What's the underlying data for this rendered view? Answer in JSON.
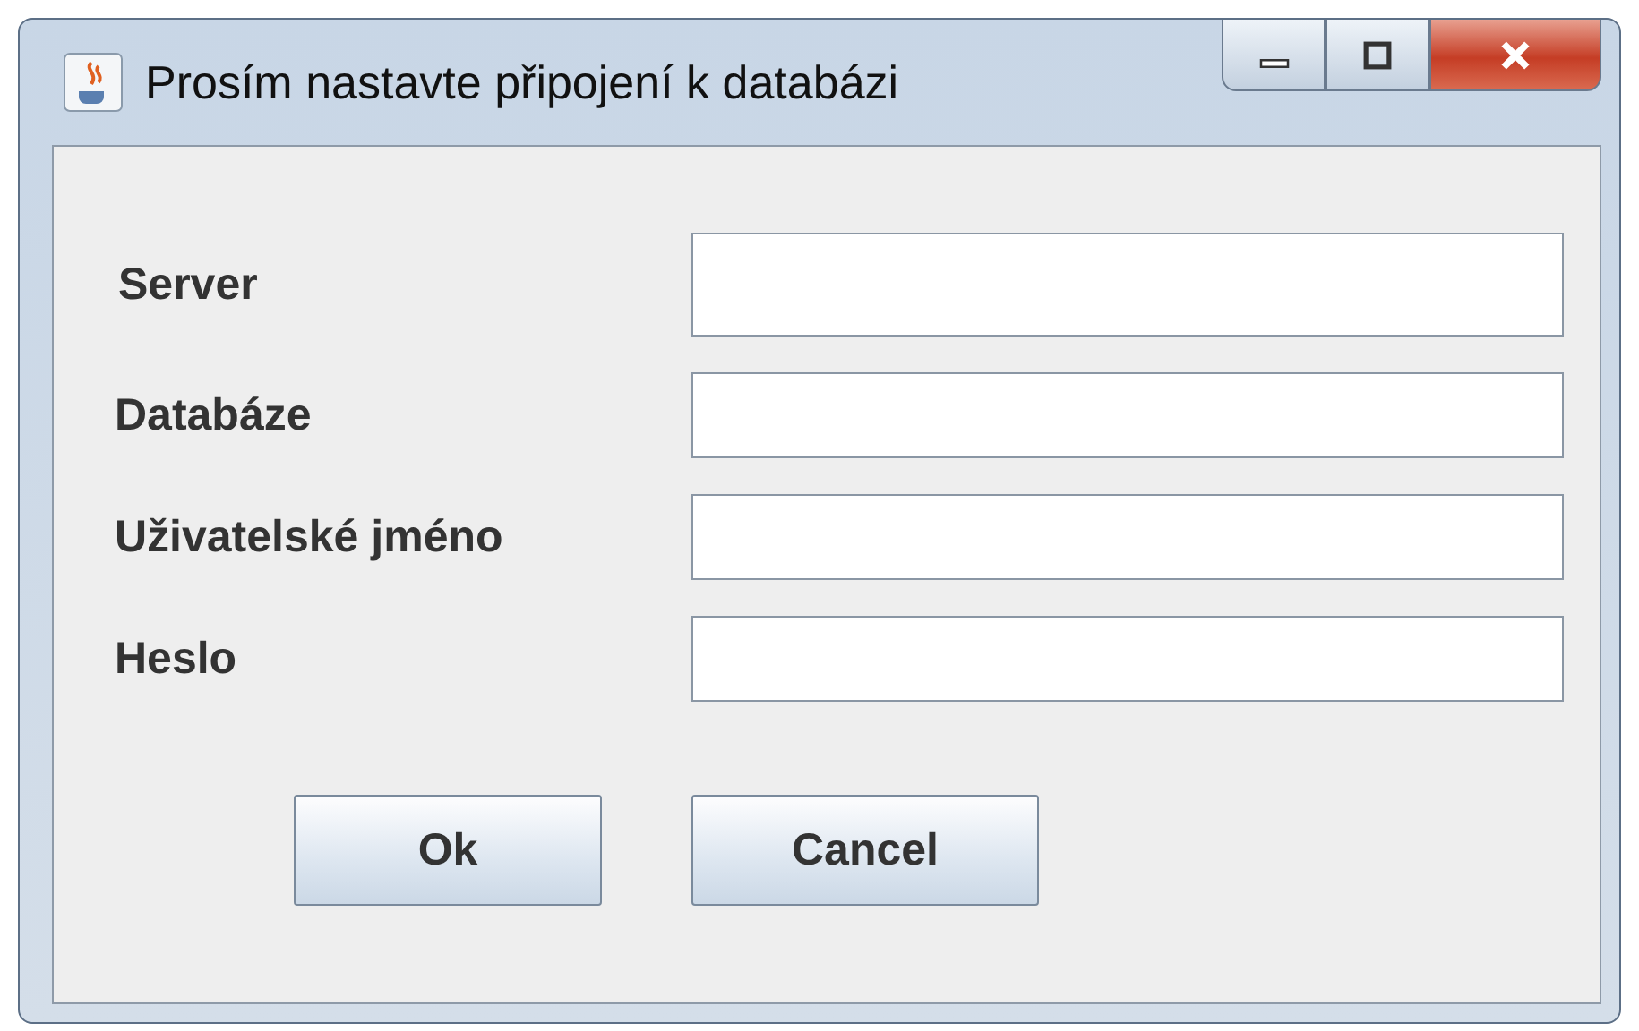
{
  "window": {
    "title": "Prosím nastavte připojení k databázi"
  },
  "fields": [
    {
      "label": "Server"
    },
    {
      "label": "Databáze"
    },
    {
      "label": "Uživatelské jméno"
    },
    {
      "label": "Heslo"
    }
  ],
  "buttons": [
    "Ok",
    "Cancel"
  ]
}
